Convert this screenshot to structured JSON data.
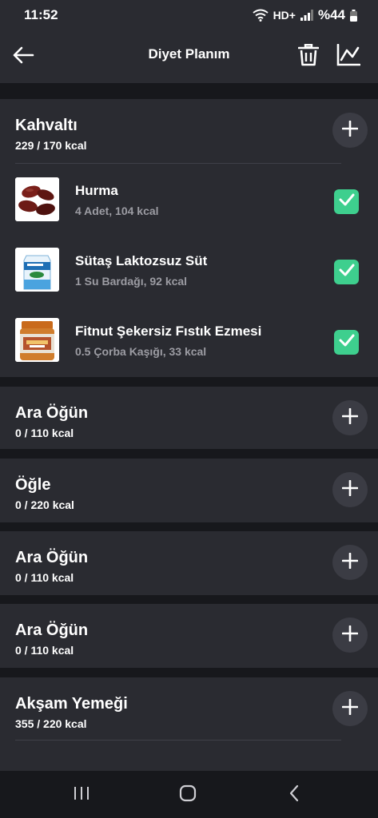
{
  "status_bar": {
    "time": "11:52",
    "network": "HD+",
    "battery": "%44"
  },
  "header": {
    "title": "Diyet Planım",
    "back_icon": "arrow-left-icon",
    "delete_icon": "trash-icon",
    "chart_icon": "line-chart-icon"
  },
  "meals": [
    {
      "title": "Kahvaltı",
      "kcal": "229 / 170 kcal",
      "items": [
        {
          "name": "Hurma",
          "desc": "4 Adet, 104 kcal",
          "checked": true
        },
        {
          "name": "Sütaş Laktozsuz Süt",
          "desc": "1 Su Bardağı, 92 kcal",
          "checked": true
        },
        {
          "name": "Fitnut Şekersiz Fıstık Ezmesi",
          "desc": "0.5 Çorba Kaşığı, 33 kcal",
          "checked": true
        }
      ]
    },
    {
      "title": "Ara Öğün",
      "kcal": "0 / 110 kcal",
      "items": []
    },
    {
      "title": "Öğle",
      "kcal": "0 / 220 kcal",
      "items": []
    },
    {
      "title": "Ara Öğün",
      "kcal": "0 / 110 kcal",
      "items": []
    },
    {
      "title": "Ara Öğün",
      "kcal": "0 / 110 kcal",
      "items": []
    },
    {
      "title": "Akşam Yemeği",
      "kcal": "355 / 220 kcal",
      "items": []
    }
  ],
  "colors": {
    "background": "#17181c",
    "card": "#2a2b31",
    "check": "#3ecf8e",
    "muted_text": "#9c9ca3"
  }
}
